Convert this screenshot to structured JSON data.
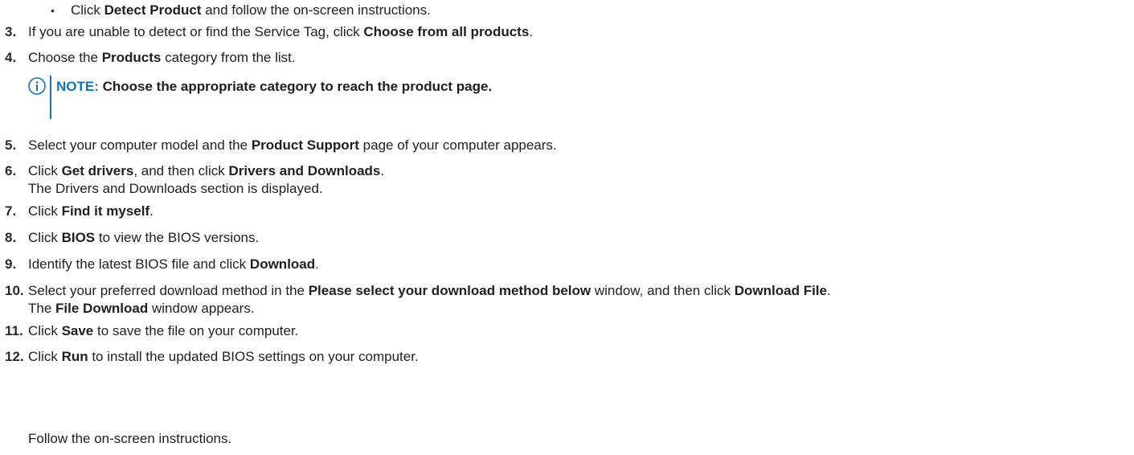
{
  "bullet": {
    "marker": "•",
    "pre": "Click ",
    "bold": "Detect Product",
    "post": " and follow the on-screen instructions."
  },
  "steps": [
    {
      "num": "3.",
      "lines": [
        {
          "parts": [
            {
              "t": "If you are unable to detect or find the Service Tag, click ",
              "b": false
            },
            {
              "t": "Choose from all products",
              "b": true
            },
            {
              "t": ".",
              "b": false
            }
          ]
        }
      ]
    },
    {
      "num": "4.",
      "lines": [
        {
          "parts": [
            {
              "t": "Choose the ",
              "b": false
            },
            {
              "t": "Products",
              "b": true
            },
            {
              "t": " category from the list.",
              "b": false
            }
          ]
        }
      ]
    },
    {
      "num": "5.",
      "lines": [
        {
          "parts": [
            {
              "t": "Select your computer model and the ",
              "b": false
            },
            {
              "t": "Product Support",
              "b": true
            },
            {
              "t": " page of your computer appears.",
              "b": false
            }
          ]
        }
      ]
    },
    {
      "num": "6.",
      "lines": [
        {
          "parts": [
            {
              "t": "Click ",
              "b": false
            },
            {
              "t": "Get drivers",
              "b": true
            },
            {
              "t": ", and then click ",
              "b": false
            },
            {
              "t": "Drivers and Downloads",
              "b": true
            },
            {
              "t": ".",
              "b": false
            }
          ]
        },
        {
          "parts": [
            {
              "t": "The Drivers and Downloads section is displayed.",
              "b": false
            }
          ]
        }
      ]
    },
    {
      "num": "7.",
      "lines": [
        {
          "parts": [
            {
              "t": "Click ",
              "b": false
            },
            {
              "t": "Find it myself",
              "b": true
            },
            {
              "t": ".",
              "b": false
            }
          ]
        }
      ]
    },
    {
      "num": "8.",
      "lines": [
        {
          "parts": [
            {
              "t": "Click ",
              "b": false
            },
            {
              "t": "BIOS",
              "b": true
            },
            {
              "t": " to view the BIOS versions.",
              "b": false
            }
          ]
        }
      ]
    },
    {
      "num": "9.",
      "lines": [
        {
          "parts": [
            {
              "t": "Identify the latest BIOS file and click ",
              "b": false
            },
            {
              "t": "Download",
              "b": true
            },
            {
              "t": ".",
              "b": false
            }
          ]
        }
      ]
    },
    {
      "num": "10.",
      "lines": [
        {
          "parts": [
            {
              "t": "Select your preferred download method in the ",
              "b": false
            },
            {
              "t": "Please select your download method below",
              "b": true
            },
            {
              "t": " window, and then click ",
              "b": false
            },
            {
              "t": "Download File",
              "b": true
            },
            {
              "t": ".",
              "b": false
            }
          ]
        },
        {
          "parts": [
            {
              "t": "The ",
              "b": false
            },
            {
              "t": "File Download",
              "b": true
            },
            {
              "t": " window appears.",
              "b": false
            }
          ]
        }
      ]
    },
    {
      "num": "11.",
      "lines": [
        {
          "parts": [
            {
              "t": "Click ",
              "b": false
            },
            {
              "t": "Save",
              "b": true
            },
            {
              "t": " to save the file on your computer.",
              "b": false
            }
          ]
        }
      ]
    },
    {
      "num": "12.",
      "lines": [
        {
          "parts": [
            {
              "t": "Click ",
              "b": false
            },
            {
              "t": "Run",
              "b": true
            },
            {
              "t": " to install the updated BIOS settings on your computer.",
              "b": false
            }
          ]
        }
      ]
    }
  ],
  "note": {
    "label": "NOTE:",
    "text": " Choose the appropriate category to reach the product page."
  },
  "follow_text": "Follow the on-screen instructions.",
  "colors": {
    "accent": "#0f74c1",
    "text": "#1f1f1f"
  },
  "icons": {
    "note": "info-circle-icon"
  }
}
